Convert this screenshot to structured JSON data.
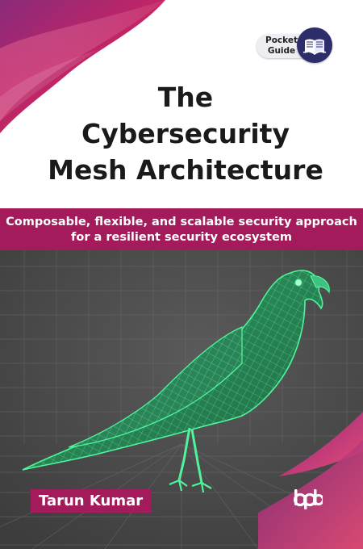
{
  "cover": {
    "badge": {
      "line1": "Pocket",
      "line2": "Guide",
      "icon": "open-book-icon"
    },
    "title": {
      "line1": "The",
      "line2": "Cybersecurity",
      "line3": "Mesh Architecture"
    },
    "subtitle": {
      "line1": "Composable, flexible, and scalable security approach",
      "line2": "for a resilient security ecosystem"
    },
    "author": "Tarun Kumar",
    "publisher": "bpb",
    "illustration": "green-wireframe-bird",
    "colors": {
      "accent": "#a31b5b",
      "background_art": "#4a4a4a",
      "wireframe": "#4ef59a",
      "badge_circle": "#2e2d6b"
    }
  }
}
